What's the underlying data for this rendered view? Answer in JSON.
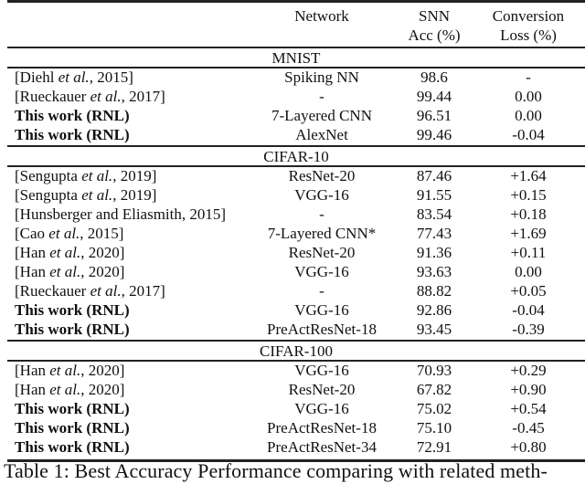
{
  "table": {
    "headers": {
      "network": "Network",
      "acc_line1": "SNN",
      "acc_line2": "Acc (%)",
      "loss_line1": "Conversion",
      "loss_line2": "Loss (%)"
    },
    "sections": [
      {
        "name": "MNIST",
        "rows": [
          {
            "pre": "[Diehl ",
            "etal": "et al.",
            "post": ", 2015]",
            "bold": false,
            "network": "Spiking NN",
            "acc": "98.6",
            "loss": "-"
          },
          {
            "pre": "[Rueckauer ",
            "etal": "et al.",
            "post": ", 2017]",
            "bold": false,
            "network": "-",
            "acc": "99.44",
            "loss": "0.00"
          },
          {
            "pre": "This work (RNL)",
            "etal": "",
            "post": "",
            "bold": true,
            "network": "7-Layered CNN",
            "acc": "96.51",
            "loss": "0.00"
          },
          {
            "pre": "This work (RNL)",
            "etal": "",
            "post": "",
            "bold": true,
            "network": "AlexNet",
            "acc": "99.46",
            "loss": "-0.04"
          }
        ]
      },
      {
        "name": "CIFAR-10",
        "rows": [
          {
            "pre": "[Sengupta ",
            "etal": "et al.",
            "post": ", 2019]",
            "bold": false,
            "network": "ResNet-20",
            "acc": "87.46",
            "loss": "+1.64"
          },
          {
            "pre": "[Sengupta ",
            "etal": "et al.",
            "post": ", 2019]",
            "bold": false,
            "network": "VGG-16",
            "acc": "91.55",
            "loss": "+0.15"
          },
          {
            "pre": "[Hunsberger and Eliasmith, 2015]",
            "etal": "",
            "post": "",
            "bold": false,
            "network": "-",
            "acc": "83.54",
            "loss": "+0.18"
          },
          {
            "pre": "[Cao ",
            "etal": "et al.",
            "post": ", 2015]",
            "bold": false,
            "network": "7-Layered CNN*",
            "acc": "77.43",
            "loss": "+1.69"
          },
          {
            "pre": "[Han ",
            "etal": "et al.",
            "post": ", 2020]",
            "bold": false,
            "network": "ResNet-20",
            "acc": "91.36",
            "loss": "+0.11"
          },
          {
            "pre": "[Han ",
            "etal": "et al.",
            "post": ", 2020]",
            "bold": false,
            "network": "VGG-16",
            "acc": "93.63",
            "loss": "0.00"
          },
          {
            "pre": "[Rueckauer ",
            "etal": "et al.",
            "post": ", 2017]",
            "bold": false,
            "network": "-",
            "acc": "88.82",
            "loss": "+0.05"
          },
          {
            "pre": "This work (RNL)",
            "etal": "",
            "post": "",
            "bold": true,
            "network": "VGG-16",
            "acc": "92.86",
            "loss": "-0.04"
          },
          {
            "pre": "This work (RNL)",
            "etal": "",
            "post": "",
            "bold": true,
            "network": "PreActResNet-18",
            "acc": "93.45",
            "loss": "-0.39"
          }
        ]
      },
      {
        "name": "CIFAR-100",
        "rows": [
          {
            "pre": "[Han ",
            "etal": "et al.",
            "post": ", 2020]",
            "bold": false,
            "network": "VGG-16",
            "acc": "70.93",
            "loss": "+0.29"
          },
          {
            "pre": "[Han ",
            "etal": "et al.",
            "post": ", 2020]",
            "bold": false,
            "network": "ResNet-20",
            "acc": "67.82",
            "loss": "+0.90"
          },
          {
            "pre": "This work (RNL)",
            "etal": "",
            "post": "",
            "bold": true,
            "network": "VGG-16",
            "acc": "75.02",
            "loss": "+0.54"
          },
          {
            "pre": "This work (RNL)",
            "etal": "",
            "post": "",
            "bold": true,
            "network": "PreActResNet-18",
            "acc": "75.10",
            "loss": "-0.45"
          },
          {
            "pre": "This work (RNL)",
            "etal": "",
            "post": "",
            "bold": true,
            "network": "PreActResNet-34",
            "acc": "72.91",
            "loss": "+0.80"
          }
        ]
      }
    ]
  },
  "caption": "Table 1: Best Accuracy Performance comparing with related meth-"
}
